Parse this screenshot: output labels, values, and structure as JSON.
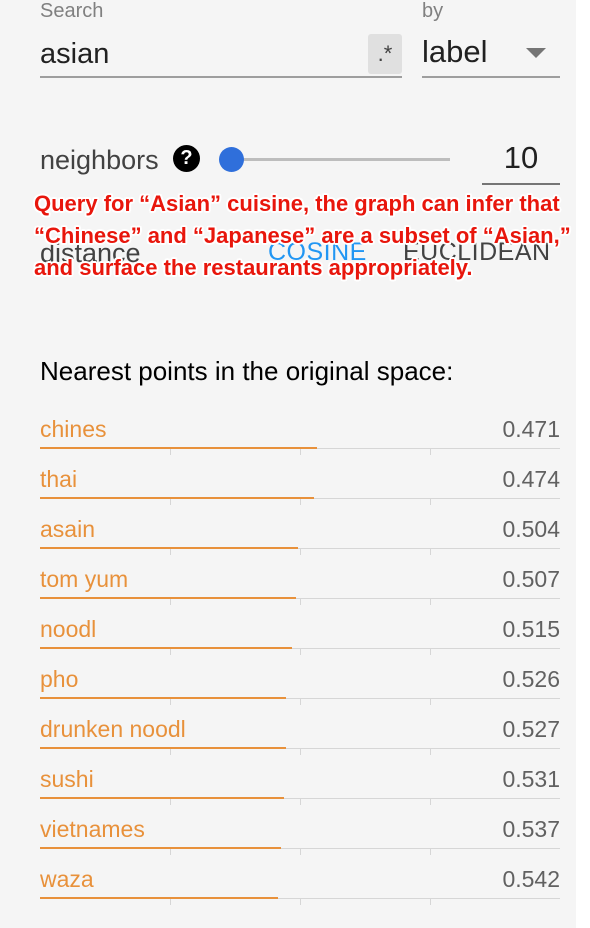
{
  "search": {
    "label": "Search",
    "value": "asian",
    "regex_label": ".*"
  },
  "by": {
    "label": "by",
    "value": "label"
  },
  "neighbors": {
    "label": "neighbors",
    "help_glyph": "?",
    "value": "10",
    "slider_fraction": 0
  },
  "distance": {
    "label": "distance",
    "options": [
      "COSINE",
      "EUCLIDEAN"
    ],
    "selected": "COSINE"
  },
  "annotation": "Query for “Asian” cuisine, the graph can infer that “Chinese” and “Japanese” are a subset of “Asian,” and surface the restaurants appropriately.",
  "results": {
    "title": "Nearest points in the original space:",
    "items": [
      {
        "label": "chines",
        "value": "0.471",
        "bar_fraction": 0.533
      },
      {
        "label": "thai",
        "value": "0.474",
        "bar_fraction": 0.526
      },
      {
        "label": "asain",
        "value": "0.504",
        "bar_fraction": 0.496
      },
      {
        "label": "tom yum",
        "value": "0.507",
        "bar_fraction": 0.493
      },
      {
        "label": "noodl",
        "value": "0.515",
        "bar_fraction": 0.485
      },
      {
        "label": "pho",
        "value": "0.526",
        "bar_fraction": 0.474
      },
      {
        "label": "drunken noodl",
        "value": "0.527",
        "bar_fraction": 0.473
      },
      {
        "label": "sushi",
        "value": "0.531",
        "bar_fraction": 0.469
      },
      {
        "label": "vietnames",
        "value": "0.537",
        "bar_fraction": 0.463
      },
      {
        "label": "waza",
        "value": "0.542",
        "bar_fraction": 0.458
      }
    ]
  },
  "colors": {
    "accent": "#e8913b",
    "selected_option": "#2196f3",
    "slider_thumb": "#2f6fdb",
    "annotation": "#e8160c",
    "panel_bg": "#f5f5f5"
  }
}
